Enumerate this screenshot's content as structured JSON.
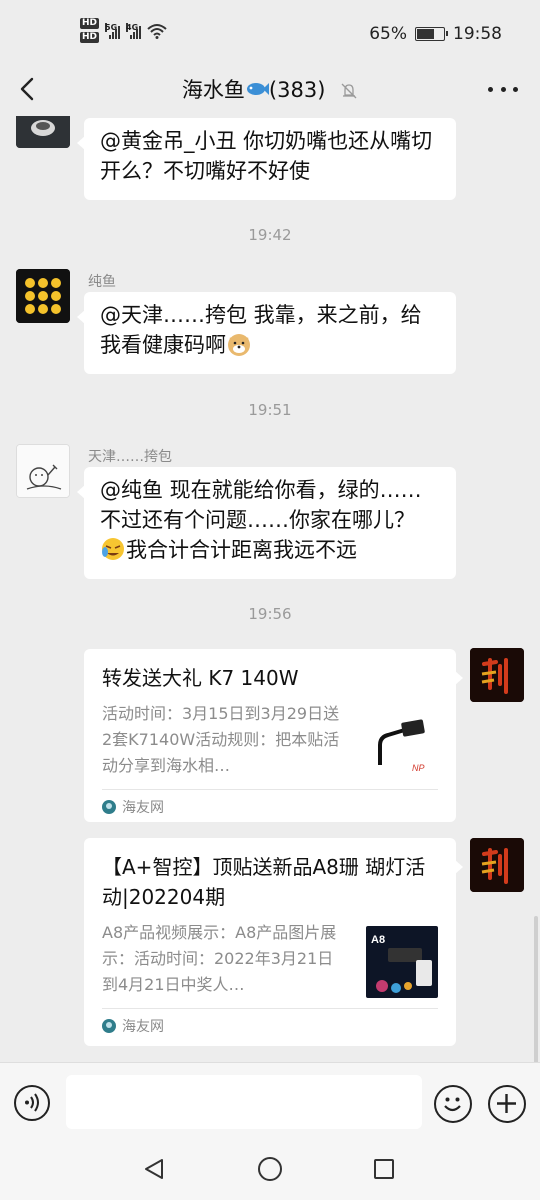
{
  "status_bar": {
    "network_1": "HD",
    "network_2": "HD",
    "signal_1": "5G",
    "signal_2": "4G",
    "battery": "65%",
    "time": "19:58"
  },
  "header": {
    "title": "海水鱼",
    "count": "(383)"
  },
  "messages": {
    "m1_text": "@黄金吊_小丑  你切奶嘴也还从嘴切开么？不切嘴好不好使",
    "t1": "19:42",
    "m2_sender": "纯鱼",
    "m2_text": "@天津……挎包  我靠，来之前，给我看健康码啊",
    "t2": "19:51",
    "m3_sender": "天津……挎包",
    "m3_text_a": "@纯鱼  现在就能给你看，绿的……不过还有个问题……你家在哪儿？",
    "m3_text_b": "我合计合计距离我远不远",
    "t3": "19:56"
  },
  "cards": [
    {
      "title": "转发送大礼  K7 140W",
      "desc": "活动时间：3月15日到3月29日送2套K7140W活动规则：把本贴活动分享到海水相…",
      "source": "海友网"
    },
    {
      "title": "【A+智控】顶贴送新品A8珊 瑚灯活动|202204期",
      "desc": "A8产品视频展示：A8产品图片展示：活动时间：2022年3月21日到4月21日中奖人…",
      "source": "海友网",
      "thumb_label": "A8"
    }
  ],
  "input": {
    "placeholder": ""
  },
  "colors": {
    "background": "#ededed",
    "bubble": "#ffffff",
    "meta_text": "#9a9a9a"
  },
  "icons": {
    "back": "chevron-left-icon",
    "mute": "bell-off-icon",
    "more": "more-dots-icon",
    "voice": "voice-icon",
    "emoji": "smiley-icon",
    "plus": "plus-icon"
  }
}
